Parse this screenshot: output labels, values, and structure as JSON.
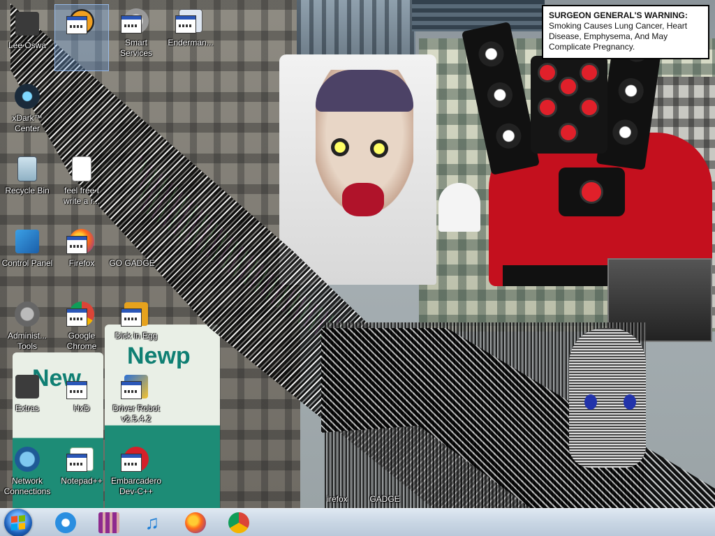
{
  "warning": {
    "heading": "SURGEON GENERAL'S WARNING:",
    "body": "Smoking Causes Lung Cancer, Heart Disease, Emphysema, And May Complicate Pregnancy."
  },
  "ads": {
    "brand": "Newport",
    "brand_partial_left": "New",
    "brand_partial_right": "Newp"
  },
  "desktop_icons": [
    {
      "label": "Lee Oswa",
      "icon": "user-folder-icon"
    },
    {
      "label": "",
      "icon": "half-life-icon"
    },
    {
      "label": "Smart Services",
      "icon": "gear-services-icon"
    },
    {
      "label": "Enderman...",
      "icon": "app-window-icon"
    },
    {
      "label": "xDark™ Center",
      "icon": "dark-center-icon"
    },
    {
      "label": "Recycle Bin",
      "icon": "recycle-bin-icon"
    },
    {
      "label": "feel free t write a r...",
      "icon": "text-file-icon"
    },
    {
      "label": "Control Panel",
      "icon": "control-panel-icon"
    },
    {
      "label": "Firefox",
      "icon": "firefox-icon"
    },
    {
      "label": "GO GADGE",
      "icon": "gadgets-icon"
    },
    {
      "label": "Administ... Tools",
      "icon": "admin-tools-icon"
    },
    {
      "label": "Google Chrome",
      "icon": "chrome-icon"
    },
    {
      "label": "Dick in Egg",
      "icon": "app-icon"
    },
    {
      "label": "Extras",
      "icon": "folder-icon"
    },
    {
      "label": "HxD",
      "icon": "hex-editor-icon"
    },
    {
      "label": "Driver Robot v2.5.4.2",
      "icon": "driver-robot-icon"
    },
    {
      "label": "Network Connections",
      "icon": "network-icon"
    },
    {
      "label": "Notepad++",
      "icon": "notepad-plus-icon"
    },
    {
      "label": "Embarcadero Dev-C++",
      "icon": "devcpp-icon"
    },
    {
      "label": "irefox",
      "icon": "firefox-icon"
    },
    {
      "label": "GADGE",
      "icon": "gadgets-icon"
    }
  ],
  "taskbar": {
    "items": [
      {
        "name": "start-button",
        "icon": "windows-logo-icon"
      },
      {
        "name": "internet-explorer",
        "icon": "internet-explorer-icon"
      },
      {
        "name": "winrar",
        "icon": "winrar-icon"
      },
      {
        "name": "itunes",
        "icon": "music-note-icon"
      },
      {
        "name": "firefox",
        "icon": "firefox-icon"
      },
      {
        "name": "chrome",
        "icon": "chrome-icon"
      }
    ]
  },
  "colors": {
    "speaker_red": "#c4101e",
    "taskbar": "#c9d6e4",
    "ad_green": "#1d8c76"
  }
}
